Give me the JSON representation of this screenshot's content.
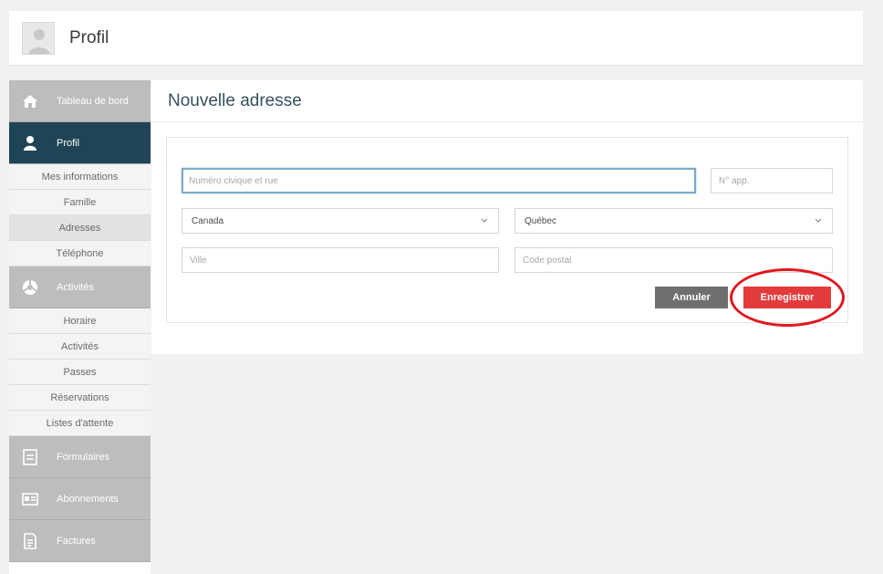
{
  "header": {
    "title": "Profil"
  },
  "sidebar": {
    "items": [
      {
        "label": "Tableau de bord",
        "icon": "home-icon",
        "active": false
      },
      {
        "label": "Profil",
        "icon": "user-icon",
        "active": true,
        "children": [
          {
            "label": "Mes informations",
            "active": false
          },
          {
            "label": "Famille",
            "active": false
          },
          {
            "label": "Adresses",
            "active": true
          },
          {
            "label": "Téléphone",
            "active": false
          }
        ]
      },
      {
        "label": "Activités",
        "icon": "activity-icon",
        "active": false,
        "children": [
          {
            "label": "Horaire"
          },
          {
            "label": "Activités"
          },
          {
            "label": "Passes"
          },
          {
            "label": "Réservations"
          },
          {
            "label": "Listes d'attente"
          }
        ]
      },
      {
        "label": "Formulaires",
        "icon": "form-icon",
        "active": false
      },
      {
        "label": "Abonnements",
        "icon": "id-card-icon",
        "active": false
      },
      {
        "label": "Factures",
        "icon": "invoice-icon",
        "active": false
      }
    ]
  },
  "main": {
    "title": "Nouvelle adresse",
    "form": {
      "street_placeholder": "Numéro civique et rue",
      "apt_placeholder": "N° app.",
      "country_value": "Canada",
      "province_value": "Québec",
      "city_placeholder": "Ville",
      "postal_placeholder": "Code postal",
      "cancel_label": "Annuler",
      "save_label": "Enregistrer"
    }
  },
  "colors": {
    "nav_active": "#1f4455",
    "nav_inactive": "#bdbdbd",
    "save_button": "#e33b3b",
    "cancel_button": "#6f6f6f",
    "highlight": "#e0171f"
  }
}
